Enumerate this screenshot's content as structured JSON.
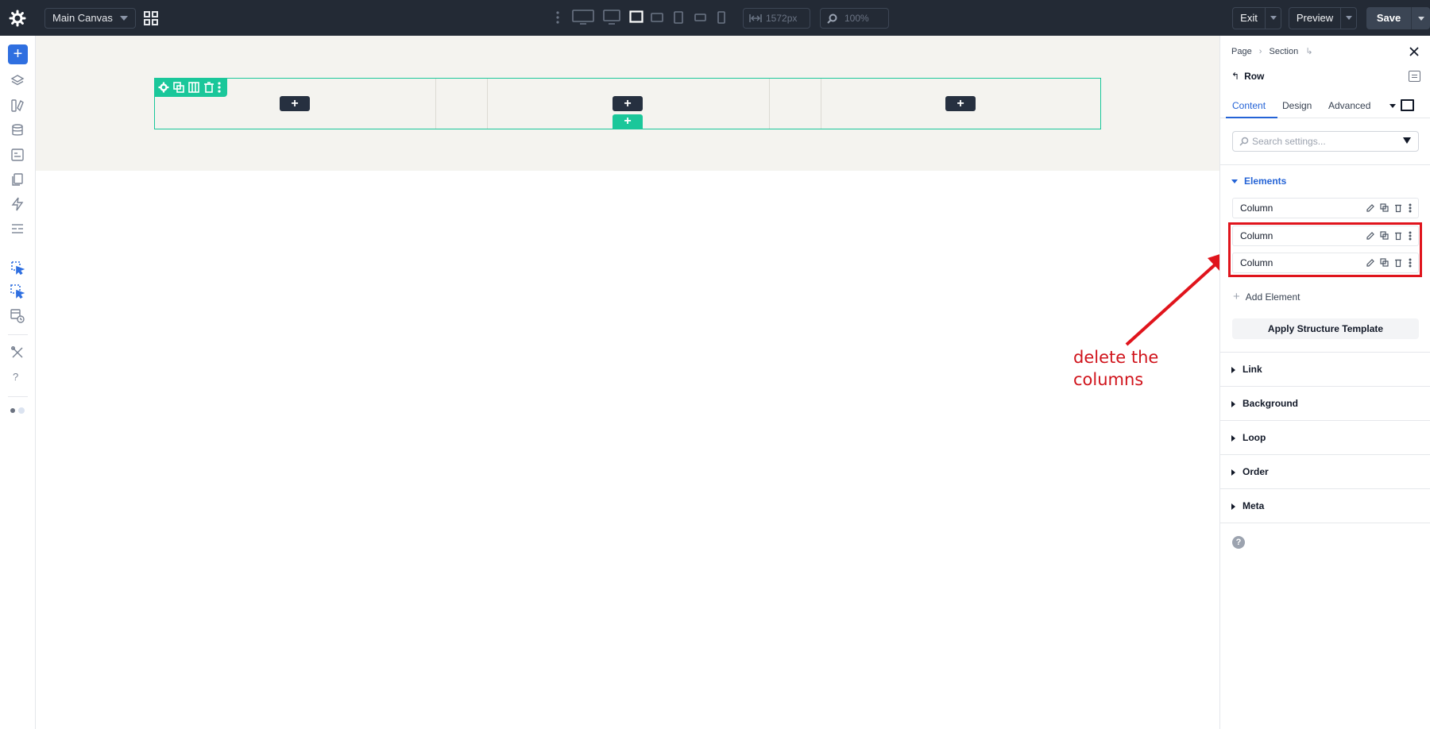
{
  "topbar": {
    "canvas_select": "Main Canvas",
    "width_value": "1572px",
    "zoom_value": "100%",
    "exit_label": "Exit",
    "preview_label": "Preview",
    "save_label": "Save"
  },
  "canvas": {
    "column_add_label": "+",
    "row_add_label": "+"
  },
  "annotation": {
    "line1": "delete the",
    "line2": "columns",
    "color": "#d0131b"
  },
  "panel": {
    "breadcrumbs": [
      "Page",
      "Section"
    ],
    "title": "Row",
    "tabs": [
      "Content",
      "Design",
      "Advanced"
    ],
    "search_placeholder": "Search settings...",
    "elements_heading": "Elements",
    "elements": [
      "Column",
      "Column",
      "Column"
    ],
    "add_element_label": "Add Element",
    "apply_template_label": "Apply Structure Template",
    "accordions": [
      "Link",
      "Background",
      "Loop",
      "Order",
      "Meta"
    ],
    "help_label": "?"
  },
  "colors": {
    "accent": "#2463d6",
    "selection": "#1ac79a",
    "topbar": "#232a35"
  }
}
